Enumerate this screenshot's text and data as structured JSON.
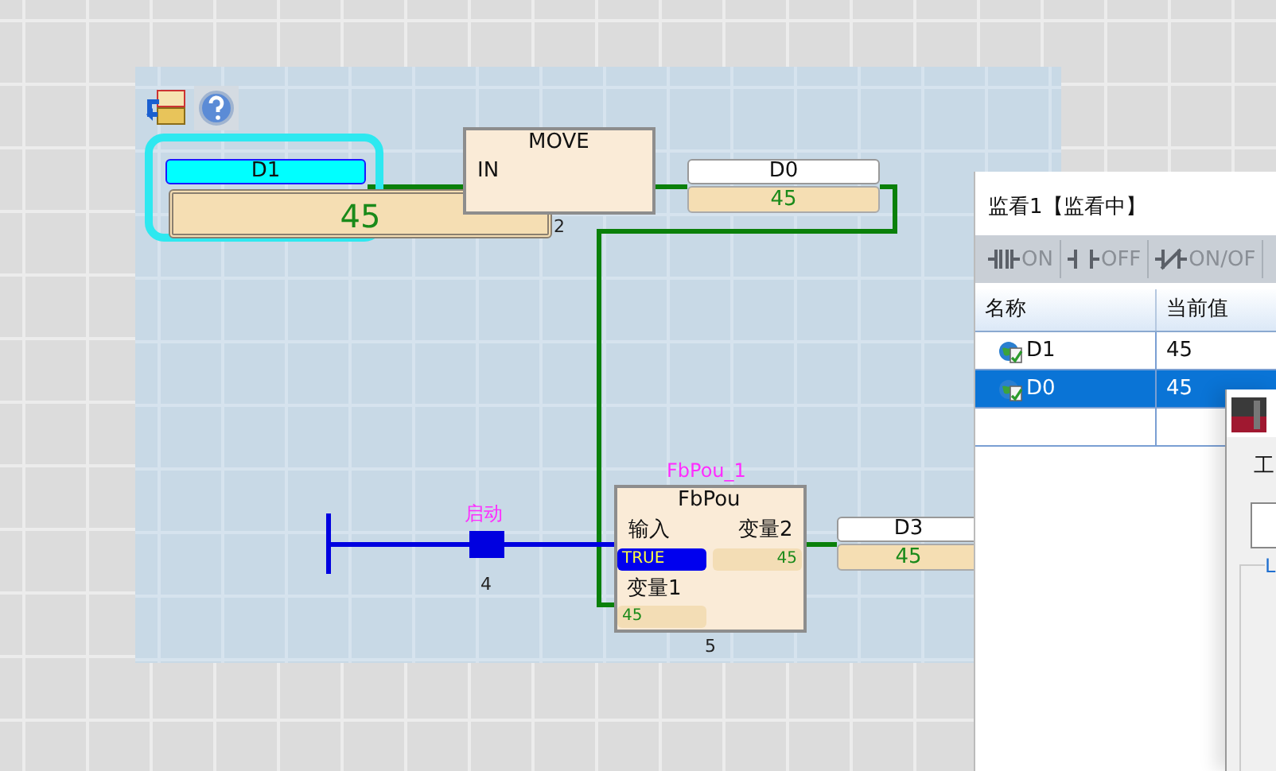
{
  "rung1": {
    "input": {
      "name": "D1",
      "value": "45",
      "selected": true,
      "number": "2"
    },
    "block": {
      "title": "MOVE",
      "pin": "IN"
    },
    "output": {
      "name": "D0",
      "value": "45"
    }
  },
  "rung2": {
    "contact": {
      "label": "启动",
      "number": "4",
      "on": true
    },
    "fb": {
      "instance": "FbPou_1",
      "type": "FbPou",
      "in_label": "输入",
      "in_value": "TRUE",
      "out_label": "变量2",
      "out_value": "45",
      "in2_label": "变量1",
      "in2_value": "45",
      "number": "5"
    },
    "output": {
      "name": "D3",
      "value": "45"
    }
  },
  "watch_window": {
    "title": "监看1【监看中】",
    "buttons": [
      {
        "label": "ON",
        "kind": "on"
      },
      {
        "label": "OFF",
        "kind": "off"
      },
      {
        "label": "ON/OF",
        "kind": "toggle"
      }
    ],
    "columns": [
      "名称",
      "当前值"
    ],
    "rows": [
      {
        "name": "D1",
        "value": "45",
        "selected": false
      },
      {
        "name": "D0",
        "value": "45",
        "selected": true
      }
    ]
  },
  "dialog": {
    "label": "工",
    "link": "L"
  }
}
